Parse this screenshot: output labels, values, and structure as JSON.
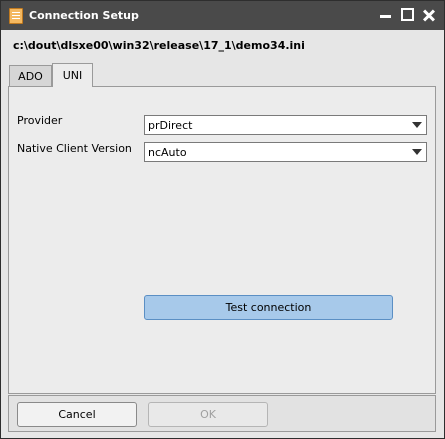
{
  "window": {
    "title": "Connection Setup",
    "file_path": "c:\\dout\\dlsxe00\\win32\\release\\17_1\\demo34.ini"
  },
  "tabs": [
    {
      "label": "ADO",
      "active": false
    },
    {
      "label": "UNI",
      "active": true
    }
  ],
  "form": {
    "provider_label": "Provider",
    "provider_value": "prDirect",
    "native_client_label": "Native Client Version",
    "native_client_value": "ncAuto",
    "test_button_label": "Test connection"
  },
  "footer": {
    "cancel_label": "Cancel",
    "ok_label": "OK",
    "ok_enabled": false
  },
  "colors": {
    "titlebar": "#4a4a4a",
    "accent_button": "#a7c9ea"
  }
}
